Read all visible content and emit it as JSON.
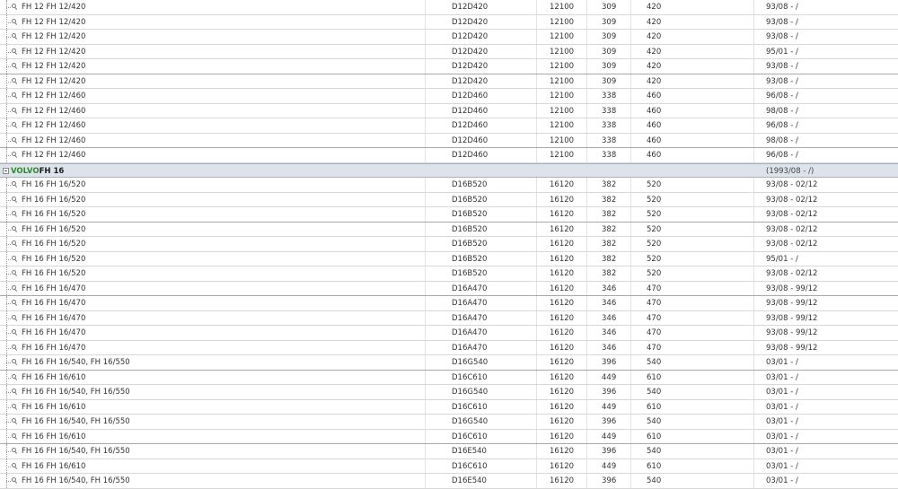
{
  "colors": {
    "brand_green": "#2b8a2b",
    "group_row_bg": "#dde3ea"
  },
  "rows": [
    {
      "kind": "item",
      "name": "FH 12 FH 12/420",
      "engine": "D12D420",
      "disp": "12100",
      "kw": "309",
      "hp": "420",
      "years": "93/08 - /"
    },
    {
      "kind": "item",
      "name": "FH 12 FH 12/420",
      "engine": "D12D420",
      "disp": "12100",
      "kw": "309",
      "hp": "420",
      "years": "93/08 - /"
    },
    {
      "kind": "item",
      "name": "FH 12 FH 12/420",
      "engine": "D12D420",
      "disp": "12100",
      "kw": "309",
      "hp": "420",
      "years": "93/08 - /"
    },
    {
      "kind": "item",
      "name": "FH 12 FH 12/420",
      "engine": "D12D420",
      "disp": "12100",
      "kw": "309",
      "hp": "420",
      "years": "95/01 - /"
    },
    {
      "kind": "item",
      "name": "FH 12 FH 12/420",
      "engine": "D12D420",
      "disp": "12100",
      "kw": "309",
      "hp": "420",
      "years": "93/08 - /"
    },
    {
      "kind": "item",
      "name": "FH 12 FH 12/420",
      "engine": "D12D420",
      "disp": "12100",
      "kw": "309",
      "hp": "420",
      "years": "93/08 - /"
    },
    {
      "kind": "item",
      "name": "FH 12 FH 12/460",
      "engine": "D12D460",
      "disp": "12100",
      "kw": "338",
      "hp": "460",
      "years": "96/08 - /"
    },
    {
      "kind": "item",
      "name": "FH 12 FH 12/460",
      "engine": "D12D460",
      "disp": "12100",
      "kw": "338",
      "hp": "460",
      "years": "98/08 - /"
    },
    {
      "kind": "item",
      "name": "FH 12 FH 12/460",
      "engine": "D12D460",
      "disp": "12100",
      "kw": "338",
      "hp": "460",
      "years": "96/08 - /"
    },
    {
      "kind": "item",
      "name": "FH 12 FH 12/460",
      "engine": "D12D460",
      "disp": "12100",
      "kw": "338",
      "hp": "460",
      "years": "98/08 - /"
    },
    {
      "kind": "item",
      "name": "FH 12 FH 12/460",
      "engine": "D12D460",
      "disp": "12100",
      "kw": "338",
      "hp": "460",
      "years": "96/08 - /"
    },
    {
      "kind": "group",
      "make": "VOLVO",
      "model": "FH 16",
      "years": "(1993/08 - /)"
    },
    {
      "kind": "item",
      "name": "FH 16 FH 16/520",
      "engine": "D16B520",
      "disp": "16120",
      "kw": "382",
      "hp": "520",
      "years": "93/08 - 02/12"
    },
    {
      "kind": "item",
      "name": "FH 16 FH 16/520",
      "engine": "D16B520",
      "disp": "16120",
      "kw": "382",
      "hp": "520",
      "years": "93/08 - 02/12"
    },
    {
      "kind": "item",
      "name": "FH 16 FH 16/520",
      "engine": "D16B520",
      "disp": "16120",
      "kw": "382",
      "hp": "520",
      "years": "93/08 - 02/12"
    },
    {
      "kind": "item",
      "name": "FH 16 FH 16/520",
      "engine": "D16B520",
      "disp": "16120",
      "kw": "382",
      "hp": "520",
      "years": "93/08 - 02/12"
    },
    {
      "kind": "item",
      "name": "FH 16 FH 16/520",
      "engine": "D16B520",
      "disp": "16120",
      "kw": "382",
      "hp": "520",
      "years": "93/08 - 02/12"
    },
    {
      "kind": "item",
      "name": "FH 16 FH 16/520",
      "engine": "D16B520",
      "disp": "16120",
      "kw": "382",
      "hp": "520",
      "years": "95/01 - /"
    },
    {
      "kind": "item",
      "name": "FH 16 FH 16/520",
      "engine": "D16B520",
      "disp": "16120",
      "kw": "382",
      "hp": "520",
      "years": "93/08 - 02/12"
    },
    {
      "kind": "item",
      "name": "FH 16 FH 16/470",
      "engine": "D16A470",
      "disp": "16120",
      "kw": "346",
      "hp": "470",
      "years": "93/08 - 99/12"
    },
    {
      "kind": "item",
      "name": "FH 16 FH 16/470",
      "engine": "D16A470",
      "disp": "16120",
      "kw": "346",
      "hp": "470",
      "years": "93/08 - 99/12"
    },
    {
      "kind": "item",
      "name": "FH 16 FH 16/470",
      "engine": "D16A470",
      "disp": "16120",
      "kw": "346",
      "hp": "470",
      "years": "93/08 - 99/12"
    },
    {
      "kind": "item",
      "name": "FH 16 FH 16/470",
      "engine": "D16A470",
      "disp": "16120",
      "kw": "346",
      "hp": "470",
      "years": "93/08 - 99/12"
    },
    {
      "kind": "item",
      "name": "FH 16 FH 16/470",
      "engine": "D16A470",
      "disp": "16120",
      "kw": "346",
      "hp": "470",
      "years": "93/08 - 99/12"
    },
    {
      "kind": "item",
      "name": "FH 16 FH 16/540, FH 16/550",
      "engine": "D16G540",
      "disp": "16120",
      "kw": "396",
      "hp": "540",
      "years": "03/01 - /"
    },
    {
      "kind": "item",
      "name": "FH 16 FH 16/610",
      "engine": "D16C610",
      "disp": "16120",
      "kw": "449",
      "hp": "610",
      "years": "03/01 - /"
    },
    {
      "kind": "item",
      "name": "FH 16 FH 16/540, FH 16/550",
      "engine": "D16G540",
      "disp": "16120",
      "kw": "396",
      "hp": "540",
      "years": "03/01 - /"
    },
    {
      "kind": "item",
      "name": "FH 16 FH 16/610",
      "engine": "D16C610",
      "disp": "16120",
      "kw": "449",
      "hp": "610",
      "years": "03/01 - /"
    },
    {
      "kind": "item",
      "name": "FH 16 FH 16/540, FH 16/550",
      "engine": "D16G540",
      "disp": "16120",
      "kw": "396",
      "hp": "540",
      "years": "03/01 - /"
    },
    {
      "kind": "item",
      "name": "FH 16 FH 16/610",
      "engine": "D16C610",
      "disp": "16120",
      "kw": "449",
      "hp": "610",
      "years": "03/01 - /"
    },
    {
      "kind": "item",
      "name": "FH 16 FH 16/540, FH 16/550",
      "engine": "D16E540",
      "disp": "16120",
      "kw": "396",
      "hp": "540",
      "years": "03/01 - /"
    },
    {
      "kind": "item",
      "name": "FH 16 FH 16/610",
      "engine": "D16C610",
      "disp": "16120",
      "kw": "449",
      "hp": "610",
      "years": "03/01 - /"
    },
    {
      "kind": "item",
      "name": "FH 16 FH 16/540, FH 16/550",
      "engine": "D16E540",
      "disp": "16120",
      "kw": "396",
      "hp": "540",
      "years": "03/01 - /"
    }
  ]
}
